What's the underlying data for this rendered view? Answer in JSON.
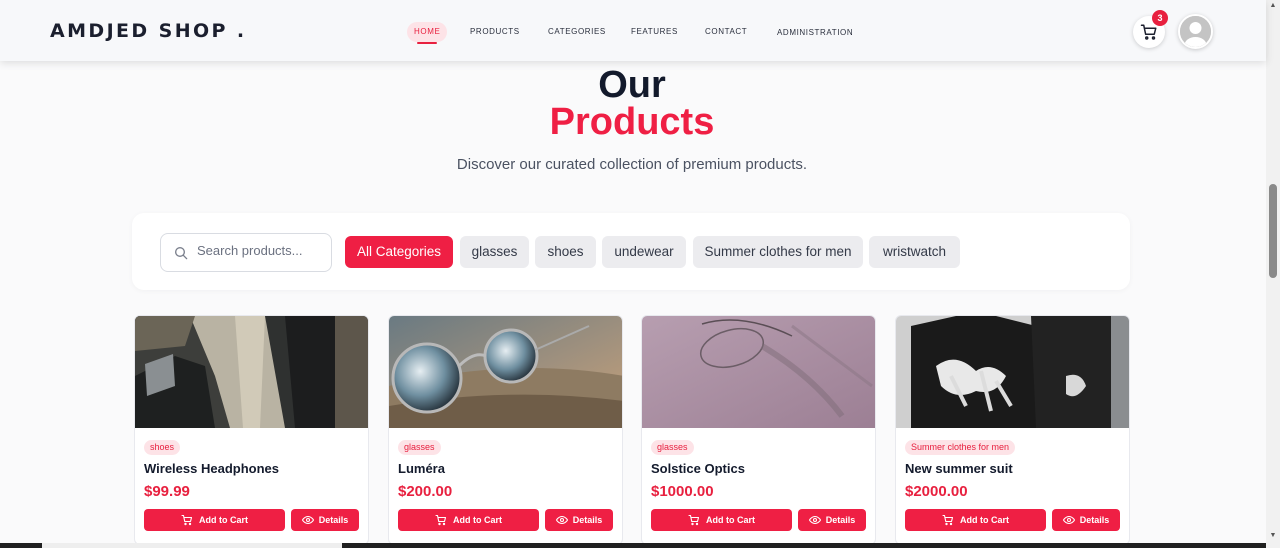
{
  "header": {
    "logo": "AMDJED SHOP .",
    "nav": [
      {
        "label": "HOME",
        "active": true
      },
      {
        "label": "PRODUCTS"
      },
      {
        "label": "CATEGORIES"
      },
      {
        "label": "FEATURES"
      },
      {
        "label": "CONTACT"
      },
      {
        "label": "ADMINISTRATION"
      }
    ],
    "cart_count": "3",
    "cart_icon": "cart-icon",
    "avatar_icon": "user-avatar-icon"
  },
  "hero": {
    "title_line1": "Our",
    "title_line2": "Products",
    "subtitle": "Discover our curated collection of premium products."
  },
  "filters": {
    "search_placeholder": "Search products...",
    "search_icon": "search-icon",
    "categories": [
      "All Categories",
      "glasses",
      "shoes",
      "undewear",
      "Summer clothes for men",
      "wristwatch"
    ],
    "active_category": "All Categories"
  },
  "products": [
    {
      "category": "shoes",
      "name": "Wireless Headphones",
      "price": "$99.99",
      "add_label": "Add to Cart",
      "details_label": "Details"
    },
    {
      "category": "glasses",
      "name": "Luméra",
      "price": "$200.00",
      "add_label": "Add to Cart",
      "details_label": "Details"
    },
    {
      "category": "glasses",
      "name": "Solstice Optics",
      "price": "$1000.00",
      "add_label": "Add to Cart",
      "details_label": "Details"
    },
    {
      "category": "Summer clothes for men",
      "name": "New summer suit",
      "price": "$2000.00",
      "add_label": "Add to Cart",
      "details_label": "Details"
    }
  ],
  "colors": {
    "accent": "#ef1f44",
    "accent_soft": "#fde3e7",
    "text_dark": "#141b2d",
    "chip_bg": "#ececef"
  }
}
